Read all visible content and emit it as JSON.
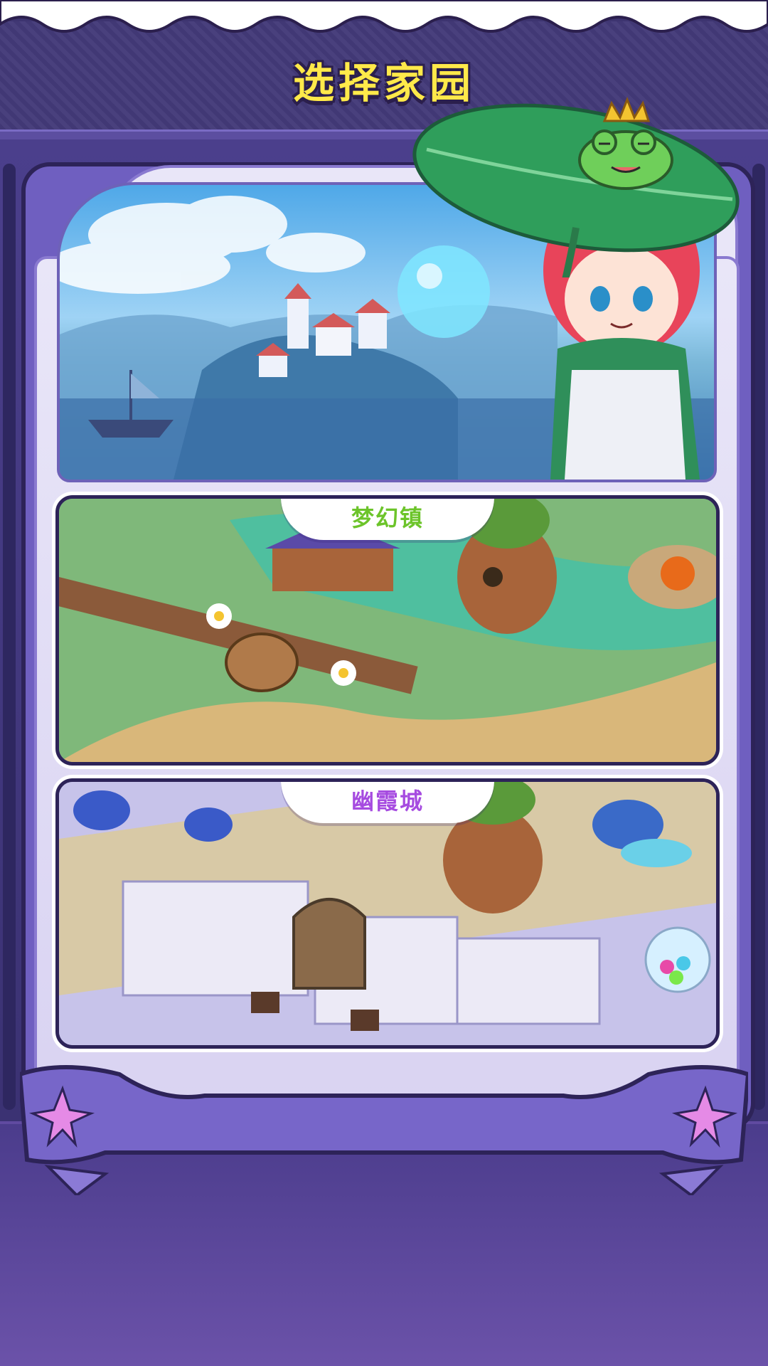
{
  "header": {
    "title": "选择家园"
  },
  "homes": [
    {
      "name": "梦幻镇",
      "theme": "green"
    },
    {
      "name": "幽霞城",
      "theme": "purple"
    }
  ],
  "colors": {
    "title_yellow": "#ffe94a",
    "frame_purple": "#6f5fc0",
    "tag_green": "#6cc42a",
    "tag_purple": "#a64be0"
  },
  "icons": [
    "star-icon",
    "crown-icon",
    "frog-icon",
    "leaf-umbrella-icon"
  ]
}
